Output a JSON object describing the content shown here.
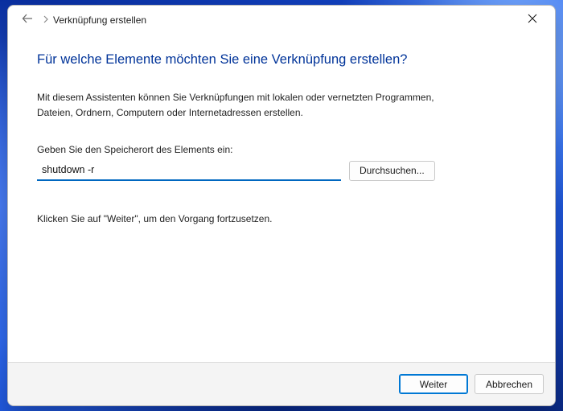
{
  "window": {
    "breadcrumb_title": "Verknüpfung erstellen"
  },
  "wizard": {
    "headline": "Für welche Elemente möchten Sie eine Verknüpfung erstellen?",
    "description": "Mit diesem Assistenten können Sie Verknüpfungen mit lokalen oder vernetzten Programmen, Dateien, Ordnern, Computern oder Internetadressen erstellen.",
    "location_label": "Geben Sie den Speicherort des Elements ein:",
    "location_value": "shutdown -r",
    "browse_label": "Durchsuchen...",
    "continue_hint": "Klicken Sie auf \"Weiter\", um den Vorgang fortzusetzen."
  },
  "footer": {
    "next_label": "Weiter",
    "cancel_label": "Abbrechen"
  }
}
